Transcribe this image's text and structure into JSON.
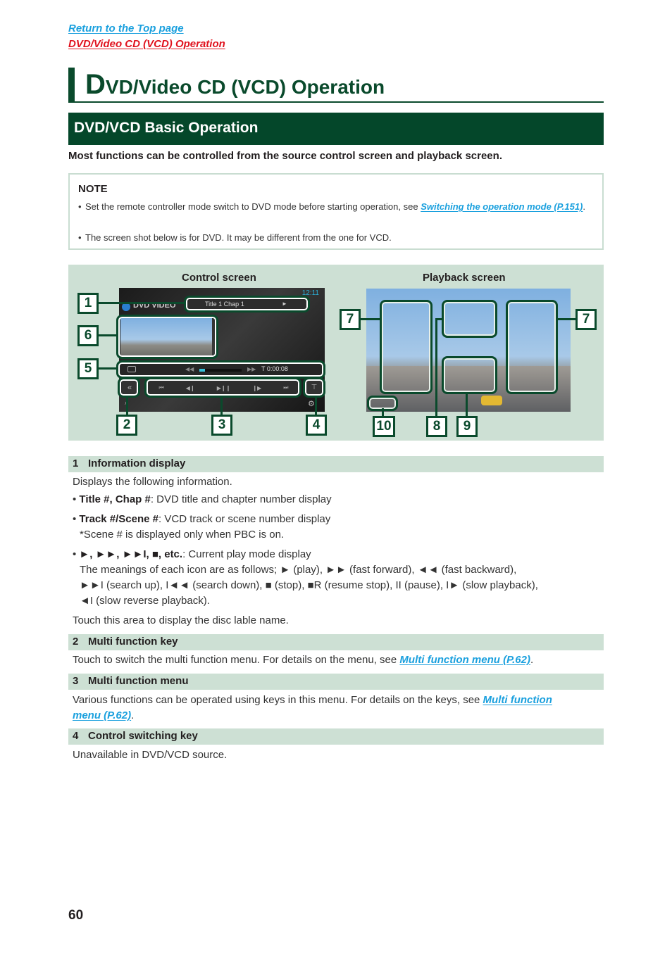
{
  "nav": {
    "top_link": "Return to the Top page",
    "section_link": "DVD/Video CD (VCD) Operation"
  },
  "heading": {
    "initial": "D",
    "rest": "VD/Video CD (VCD) Operation"
  },
  "subheading": "DVD/VCD Basic Operation",
  "intro": "Most functions can be controlled from the source control screen and playback screen.",
  "note": {
    "title": "NOTE",
    "items": [
      {
        "text": "Set the remote controller mode switch to DVD mode before starting operation, see ",
        "link": "Switching the operation mode (P.151)",
        "after": "."
      },
      {
        "text": "The screen shot below is for DVD. It may be different from the one for VCD.",
        "link": "",
        "after": ""
      }
    ]
  },
  "figure": {
    "control_caption": "Control screen",
    "playback_caption": "Playback screen",
    "control_screen": {
      "source_label": "DVD VIDEO",
      "clock": "12:11",
      "info": "Title 1 Chap   1",
      "play_state": "►",
      "time": "T 0:00:08",
      "menu_keys": [
        "⏮",
        "◀❙",
        "▶❙❙",
        "❙▶",
        "⏭"
      ],
      "progress": 0.08
    },
    "callouts": [
      "1",
      "6",
      "5",
      "2",
      "3",
      "4",
      "7",
      "7",
      "10",
      "8",
      "9"
    ]
  },
  "sections": [
    {
      "num": "1",
      "title": "Information display"
    },
    {
      "num": "2",
      "title": "Multi function key"
    },
    {
      "num": "3",
      "title": "Multi function menu"
    },
    {
      "num": "4",
      "title": "Control switching key"
    }
  ],
  "s1": {
    "intro": "Displays the following information.",
    "b1_bold": "Title #, Chap #",
    "b1_rest": ": DVD title and chapter number display",
    "b2_bold": "Track #/Scene #",
    "b2_rest": ": VCD track or scene number display",
    "b2_note": "*Scene # is displayed only when PBC is on.",
    "b3_bold": "►, ►►, ►►I, ■, etc.",
    "b3_rest": ": Current play mode display",
    "b3_line1": "The meanings of each icon are as follows; ► (play), ►► (fast forward), ◄◄ (fast backward),",
    "b3_line2": "►►I (search up), I◄◄ (search down), ■ (stop), ■R (resume stop), II (pause), I► (slow playback),",
    "b3_line3": "◄I (slow reverse playback).",
    "outro": "Touch this area to display the disc lable name."
  },
  "s2": {
    "text": "Touch to switch the multi function menu. For details on the menu, see ",
    "link": "Multi function menu (P.62)",
    "after": "."
  },
  "s3": {
    "text": "Various functions can be operated using keys in this menu. For details on the keys, see ",
    "link1": "Multi function",
    "link2": "menu (P.62)",
    "after": "."
  },
  "s4": {
    "text": "Unavailable in DVD/VCD source."
  },
  "page_number": "60",
  "colors": {
    "brand_green": "#04472a",
    "section_bg": "#cde0d4",
    "link_blue": "#1aa0de",
    "link_red": "#e0121e"
  }
}
